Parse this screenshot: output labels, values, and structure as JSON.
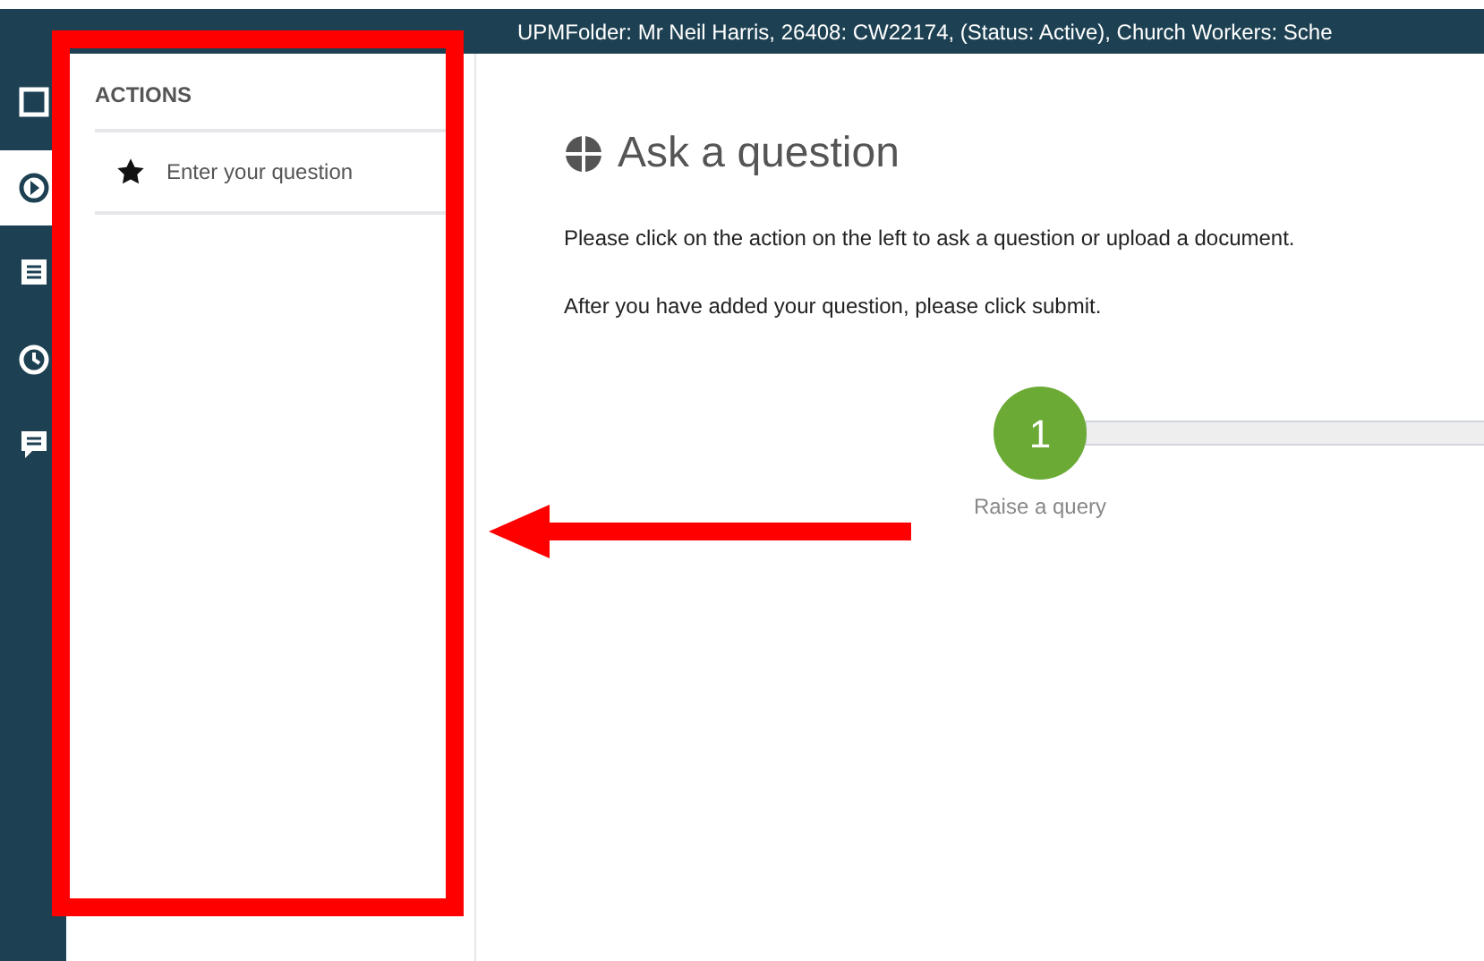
{
  "header": {
    "title": "UPMFolder: Mr Neil Harris, 26408: CW22174, (Status: Active), Church Workers: Sche"
  },
  "rail": [
    {
      "selected": false
    },
    {
      "selected": true
    },
    {
      "selected": false
    },
    {
      "selected": false
    },
    {
      "selected": false
    }
  ],
  "actions_panel": {
    "heading": "ACTIONS",
    "items": [
      {
        "label": "Enter your question"
      }
    ]
  },
  "main": {
    "title": "Ask a question",
    "paragraphs": [
      "Please click on the action on the left to ask a question or upload a document.",
      "After you have added your question, please click submit."
    ],
    "steps": [
      {
        "number": "1",
        "label": "Raise a query",
        "active": true
      }
    ]
  }
}
